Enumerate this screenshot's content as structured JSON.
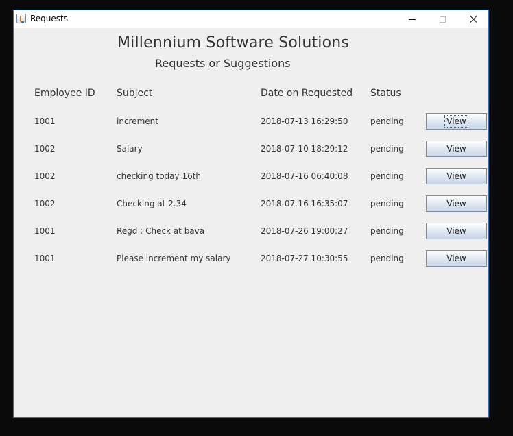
{
  "window": {
    "title": "Requests",
    "controls": [
      "minimize-icon",
      "maximize-icon",
      "close-icon"
    ]
  },
  "header": {
    "company": "Millennium Software Solutions",
    "subtitle": "Requests or Suggestions"
  },
  "table": {
    "columns": [
      "Employee ID",
      "Subject",
      "Date on Requested",
      "Status"
    ],
    "rows": [
      {
        "employee_id": "1001",
        "subject": "increment",
        "date": "2018-07-13 16:29:50",
        "status": "pending",
        "action": "View"
      },
      {
        "employee_id": "1002",
        "subject": "Salary",
        "date": "2018-07-10 18:29:12",
        "status": "pending",
        "action": "View"
      },
      {
        "employee_id": "1002",
        "subject": "checking today 16th",
        "date": "2018-07-16 06:40:08",
        "status": "pending",
        "action": "View"
      },
      {
        "employee_id": "1002",
        "subject": "Checking at 2.34",
        "date": "2018-07-16 16:35:07",
        "status": "pending",
        "action": "View"
      },
      {
        "employee_id": "1001",
        "subject": "Regd : Check at bava",
        "date": "2018-07-26 19:00:27",
        "status": "pending",
        "action": "View"
      },
      {
        "employee_id": "1001",
        "subject": "Please increment my salary",
        "date": "2018-07-27 10:30:55",
        "status": "pending",
        "action": "View"
      }
    ]
  },
  "colors": {
    "window_border": "#2f6fbf",
    "background": "#efefef",
    "text": "#333333",
    "button_border": "#7a8ea8"
  }
}
